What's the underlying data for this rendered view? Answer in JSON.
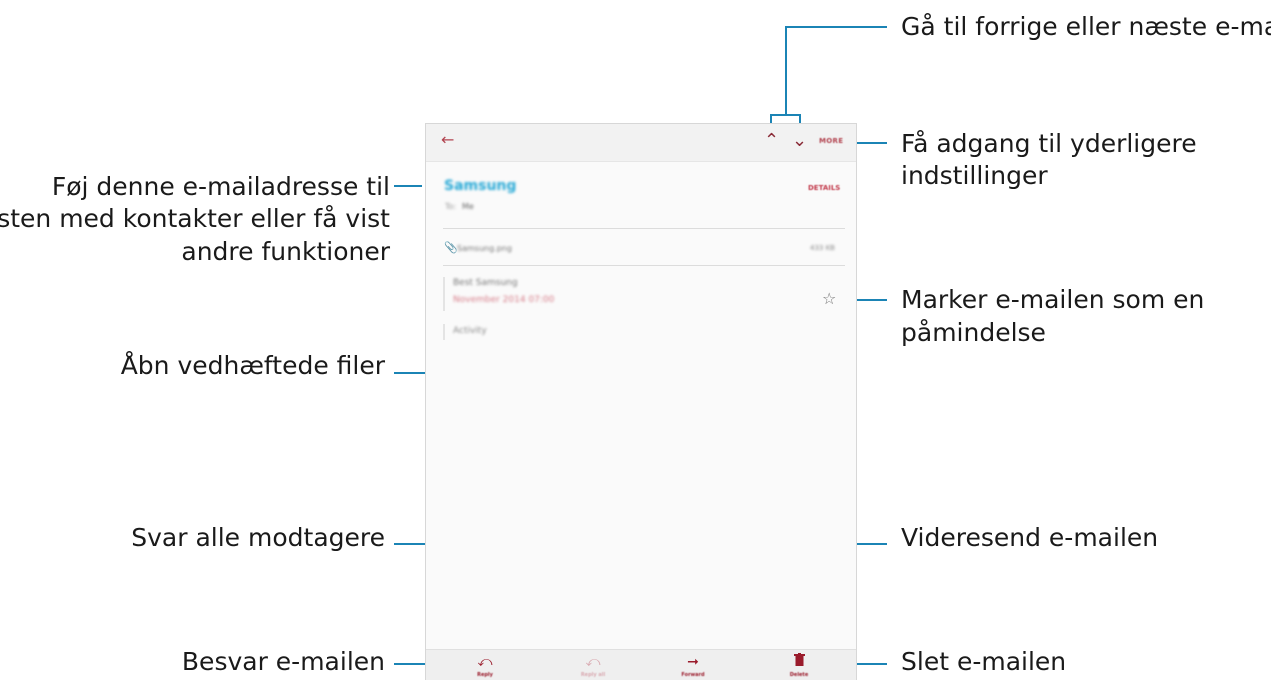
{
  "callouts": {
    "nav": "Gå til forrige eller næste e-mail",
    "more_1": "Få adgang til yderligere",
    "more_2": "indstillinger",
    "contact_1": "Føj denne e-mailadresse til",
    "contact_2": "listen med kontakter eller få vist",
    "contact_3": "andre funktioner",
    "star_1": "Marker e-mailen som en",
    "star_2": "påmindelse",
    "attachment": "Åbn vedhæftede filer",
    "reply_all": "Svar alle modtagere",
    "forward": "Videresend e-mailen",
    "reply": "Besvar e-mailen",
    "delete": "Slet e-mailen"
  },
  "email": {
    "toolbar": {
      "back_icon": "back-arrow-icon",
      "prev_icon": "chevron-up-icon",
      "next_icon": "chevron-down-icon",
      "more_label": "MORE"
    },
    "sender": "Samsung",
    "recipient_label": "To:",
    "recipient": "Me",
    "details_label": "DETAILS",
    "attachment_name": "Samsung.png",
    "attachment_size": "433 KB",
    "body_line1": "Best Samsung",
    "body_line2": "November 2014 07:00",
    "body_line3": "&nbsp;&nbsp;Activity",
    "star_icon": "star-outline-icon",
    "bottom": {
      "reply_label": "Reply",
      "reply_all_label": "Reply all",
      "forward_label": "Forward",
      "delete_label": "Delete"
    }
  },
  "colors": {
    "callout_line": "#1b84b5",
    "accent_red": "#9a1b2b",
    "sender_blue": "#28a9d6"
  }
}
